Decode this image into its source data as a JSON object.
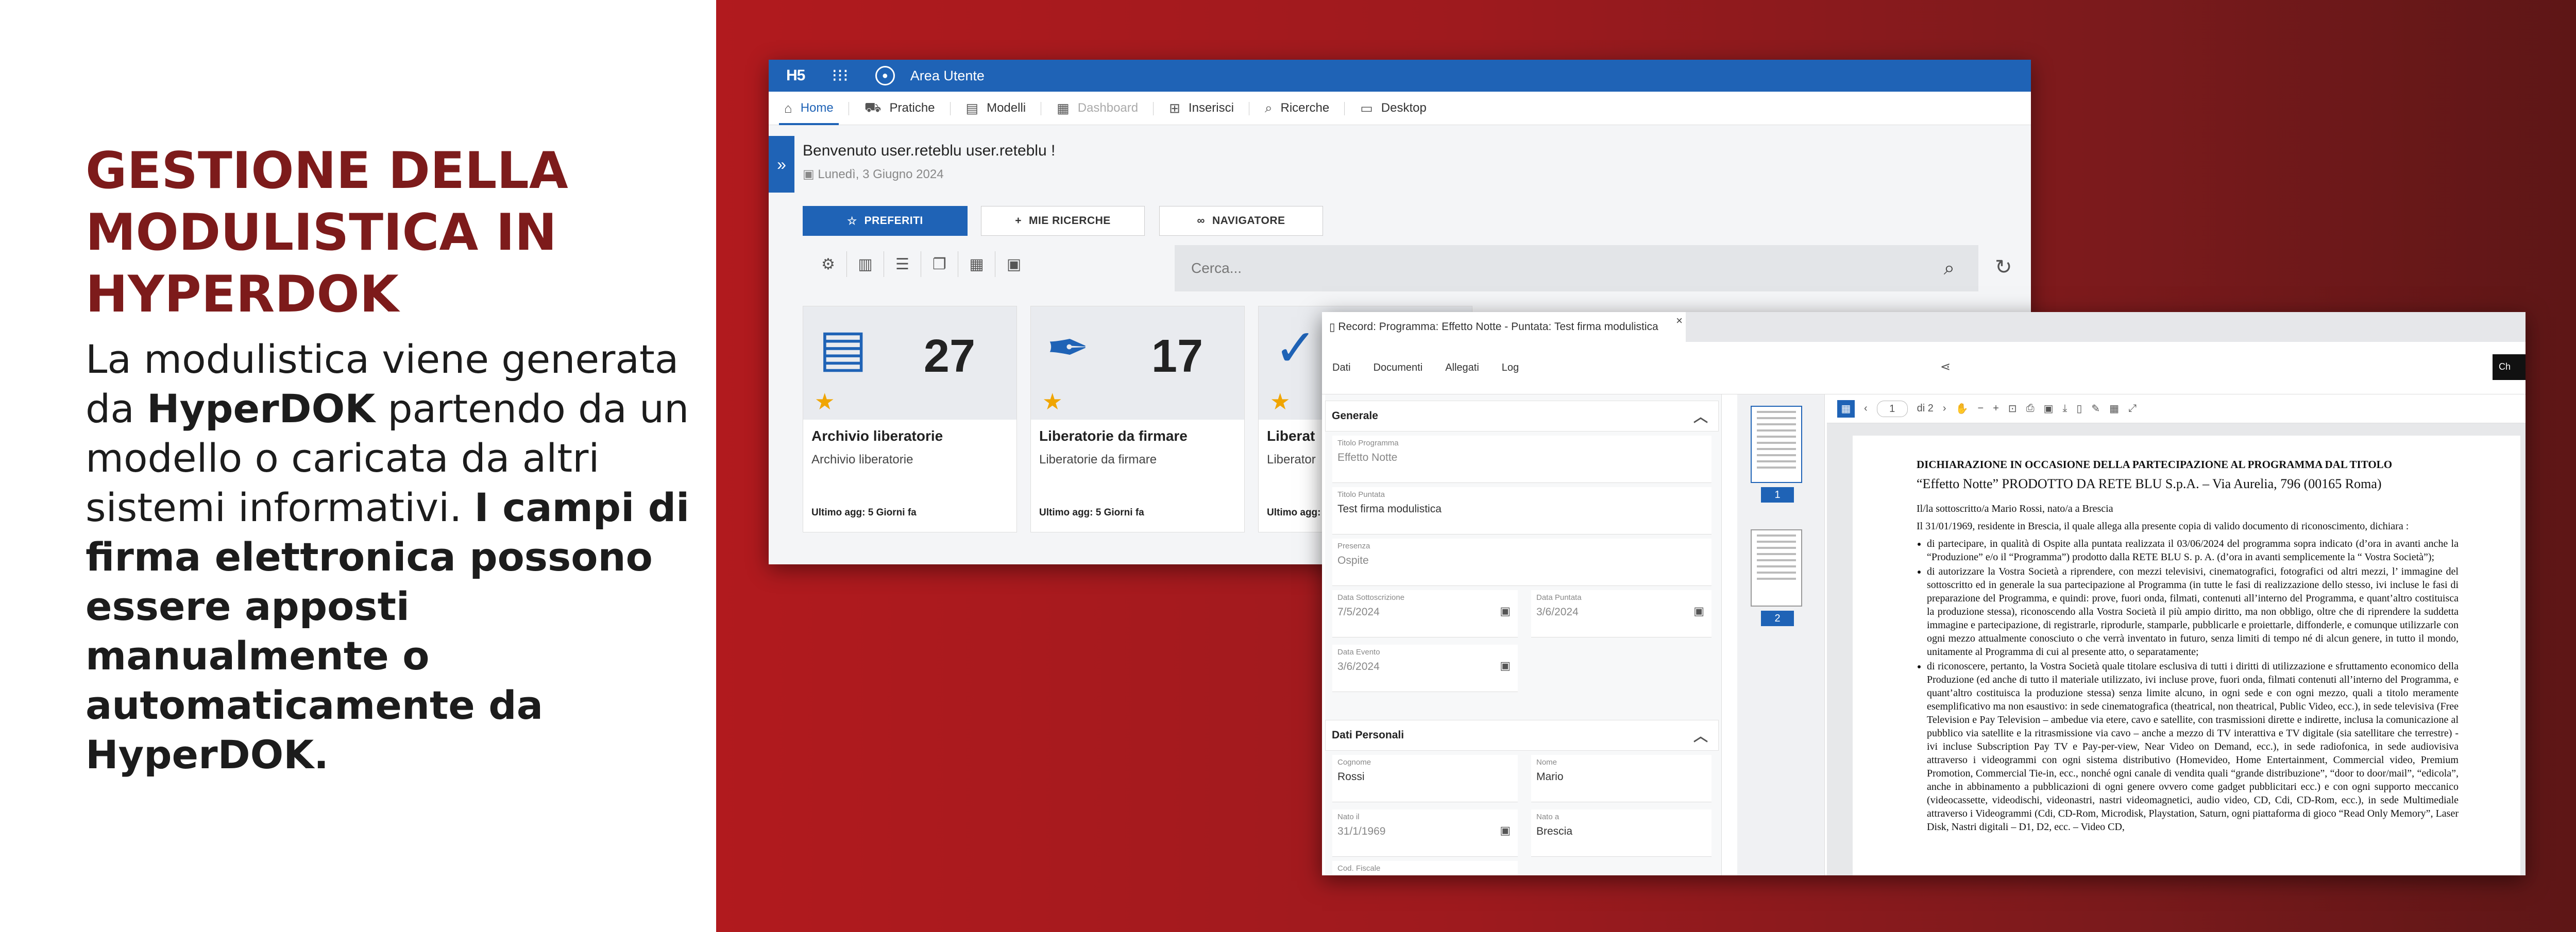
{
  "headline": "GESTIONE DELLA MODULISTICA IN HYPERDOK",
  "body": {
    "p1": "La modulistica viene generata da ",
    "brand": "HyperDOK",
    "p2": " partendo da un modello o caricata da altri sistemi informativi. ",
    "bold": "I campi di firma elettronica possono essere apposti manualmente o automaticamente da HyperDOK."
  },
  "app": {
    "logo": "H5",
    "area": "Area Utente",
    "menu": [
      "Home",
      "Pratiche",
      "Modelli",
      "Dashboard",
      "Inserisci",
      "Ricerche",
      "Desktop"
    ],
    "welcome": "Benvenuto user.reteblu user.reteblu !",
    "date": "Lunedì, 3 Giugno 2024",
    "buttons": {
      "preferiti": "PREFERITI",
      "ricerche": "MIE RICERCHE",
      "navigatore": "NAVIGATORE"
    },
    "search_placeholder": "Cerca...",
    "cards": [
      {
        "count": "27",
        "title": "Archivio liberatorie",
        "subtitle": "Archivio liberatorie",
        "updated": "Ultimo agg: 5 Giorni fa"
      },
      {
        "count": "17",
        "title": "Liberatorie da firmare",
        "subtitle": "Liberatorie da firmare",
        "updated": "Ultimo agg: 5 Giorni fa"
      },
      {
        "count": "",
        "title": "Liberat",
        "subtitle": "Liberator",
        "updated": "Ultimo agg:"
      }
    ]
  },
  "record": {
    "tab_title": "Record: Programma: Effetto Notte - Puntata: Test firma modulistica",
    "tabs": [
      "Dati",
      "Documenti",
      "Allegati",
      "Log"
    ],
    "button": "Ch",
    "sections": {
      "generale": "Generale",
      "personali": "Dati Personali"
    },
    "fields": {
      "titolo_programma": {
        "label": "Titolo Programma",
        "value": "Effetto Notte"
      },
      "titolo_puntata": {
        "label": "Titolo Puntata",
        "value": "Test firma modulistica"
      },
      "presenza": {
        "label": "Presenza",
        "value": "Ospite"
      },
      "data_sottoscrizione": {
        "label": "Data Sottoscrizione",
        "value": "7/5/2024"
      },
      "data_puntata": {
        "label": "Data Puntata",
        "value": "3/6/2024"
      },
      "data_evento": {
        "label": "Data Evento",
        "value": "3/6/2024"
      },
      "cognome": {
        "label": "Cognome",
        "value": "Rossi"
      },
      "nome": {
        "label": "Nome",
        "value": "Mario"
      },
      "nato_il": {
        "label": "Nato il",
        "value": "31/1/1969"
      },
      "nato_a": {
        "label": "Nato a",
        "value": "Brescia"
      },
      "cod_fiscale": {
        "label": "Cod. Fiscale",
        "value": ""
      }
    },
    "viewer": {
      "page": "1",
      "of": "di 2",
      "thumb1": "1",
      "thumb2": "2",
      "doc_title": "DICHIARAZIONE IN OCCASIONE DELLA PARTECIPAZIONE AL PROGRAMMA DAL TITOLO",
      "doc_subtitle": "“Effetto Notte” PRODOTTO DA RETE BLU S.p.A. – Via Aurelia, 796 (00165 Roma)",
      "line1": "Il/la sottoscritto/a Mario Rossi, nato/a a Brescia",
      "line2": "Il 31/01/1969, residente in Brescia, il quale allega alla presente copia di valido documento di riconoscimento, dichiara :",
      "bullets": [
        "di partecipare, in qualità di Ospite alla puntata realizzata il 03/06/2024 del programma sopra indicato (d’ora in avanti anche la “Produzione” e/o il “Programma”) prodotto dalla RETE BLU S. p. A. (d’ora in avanti semplicemente la “ Vostra Società”);",
        "di autorizzare la Vostra Società a riprendere, con mezzi televisivi, cinematografici, fotografici od altri mezzi, l’ immagine del sottoscritto ed in generale la sua partecipazione al Programma (in tutte le fasi di realizzazione dello stesso, ivi incluse le fasi di preparazione del Programma, e quindi: prove, fuori onda, filmati, contenuti all’interno del Programma, e quant’altro costituisca la produzione stessa), riconoscendo alla Vostra Società il più ampio diritto, ma non obbligo, oltre che di riprendere la suddetta immagine e partecipazione, di registrarle, riprodurle, stamparle, pubblicarle e proiettarle, diffonderle, e comunque utilizzarle con ogni mezzo attualmente conosciuto o che verrà inventato in futuro, senza limiti di tempo né di alcun genere, in tutto il mondo, unitamente al Programma di cui al presente atto, o separatamente;",
        "di riconoscere, pertanto, la Vostra Società quale titolare esclusiva di tutti i diritti di utilizzazione e sfruttamento economico della Produzione (ed anche di tutto il materiale utilizzato, ivi incluse prove, fuori onda, filmati contenuti all’interno del Programma, e quant’altro costituisca la produzione stessa) senza limite alcuno, in ogni sede e con ogni mezzo, quali a titolo meramente esemplificativo ma non esaustivo: in sede cinematografica (theatrical, non theatrical, Public Video, ecc.), in sede televisiva (Free Television e Pay Television – ambedue via etere, cavo e satellite, con trasmissioni dirette e indirette, inclusa la comunicazione al pubblico via satellite e la ritrasmissione via cavo – anche a mezzo di TV interattiva e TV digitale (sia satellitare che terrestre) - ivi incluse Subscription Pay TV e Pay-per-view, Near Video on Demand, ecc.), in sede radiofonica, in sede audiovisiva attraverso i videogrammi con ogni sistema distributivo (Homevideo, Home Entertainment, Commercial video, Premium Promotion, Commercial Tie-in, ecc., nonché ogni canale di vendita quali “grande distribuzione”, “door to door/mail”, “edicola”, anche in abbinamento a pubblicazioni di ogni genere ovvero come gadget pubblicitari ecc.) e con ogni supporto meccanico (videocassette, videodischi, videonastri, nastri videomagnetici, audio video, CD, Cdi, CD-Rom, ecc.), in sede Multimediale attraverso i Videogrammi (Cdi, CD-Rom, Microdisk, Playstation, Saturn, ogni piattaforma di gioco “Read Only Memory”, Laser Disk, Nastri digitali – D1, D2, ecc. – Video CD,"
      ]
    }
  }
}
